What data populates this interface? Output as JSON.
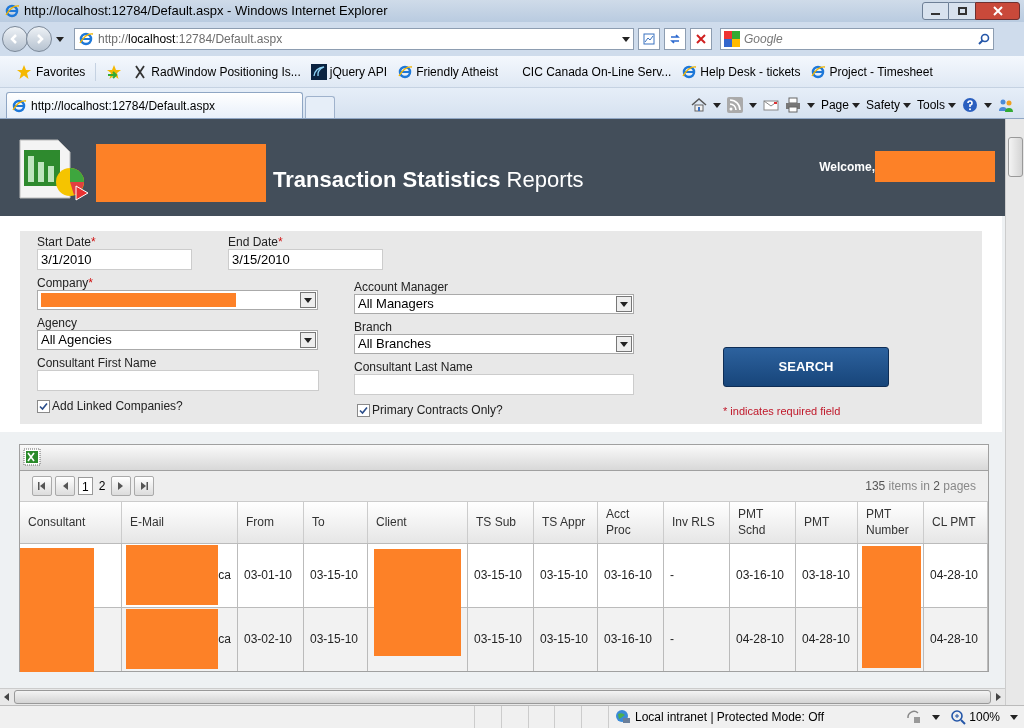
{
  "window": {
    "title": "http://localhost:12784/Default.aspx - Windows Internet Explorer"
  },
  "address_bar": {
    "host_prefix": "http://",
    "host": "localhost",
    "rest": ":12784/Default.aspx",
    "search_placeholder": "Google"
  },
  "favorites_bar": {
    "favorites_label": "Favorites",
    "links": [
      {
        "label": "RadWindow Positioning Is...",
        "kind": "cross"
      },
      {
        "label": "jQuery API",
        "kind": "swirl"
      },
      {
        "label": "Friendly Atheist",
        "kind": "ie"
      },
      {
        "label": "CIC Canada  On-Line Serv...",
        "kind": "plain"
      },
      {
        "label": "Help Desk - tickets",
        "kind": "ie"
      },
      {
        "label": "Project - Timesheet",
        "kind": "ie"
      }
    ]
  },
  "tab": {
    "label": "http://localhost:12784/Default.aspx"
  },
  "command_bar": [
    {
      "label": "Page"
    },
    {
      "label": "Safety"
    },
    {
      "label": "Tools"
    }
  ],
  "header": {
    "title_bold": "Transaction Statistics",
    "title_light": "Reports",
    "welcome": "Welcome,"
  },
  "form": {
    "fields": [
      {
        "label": "Start Date",
        "required": true,
        "kind": "text",
        "value": "3/1/2010"
      },
      {
        "label": "End Date",
        "required": true,
        "kind": "text",
        "value": "3/15/2010"
      },
      {
        "label": "Company",
        "required": true,
        "kind": "select",
        "redacted": true
      },
      {
        "label": "Account Manager",
        "required": false,
        "kind": "select",
        "value": "All Managers"
      },
      {
        "label": "Agency",
        "required": false,
        "kind": "select",
        "value": "All Agencies"
      },
      {
        "label": "Branch",
        "required": false,
        "kind": "select",
        "value": "All Branches"
      },
      {
        "label": "Consultant First Name",
        "required": false,
        "kind": "text"
      },
      {
        "label": "Consultant Last Name",
        "required": false,
        "kind": "text"
      }
    ],
    "required_mark": "*",
    "checkboxes": [
      {
        "label": "Add Linked Companies?",
        "checked": true
      },
      {
        "label": "Primary Contracts Only?",
        "checked": true
      }
    ],
    "search_button": "SEARCH",
    "required_note": "* indicates required field"
  },
  "grid": {
    "pages": [
      {
        "label": "1",
        "selected": true
      },
      {
        "label": "2",
        "selected": false
      }
    ],
    "items_count": "135",
    "items_text": "items in",
    "pages_count": "2",
    "pages_text": "pages",
    "columns": [
      "Consultant",
      "E-Mail",
      "From",
      "To",
      "Client",
      "TS Sub",
      "TS Appr",
      "Acct Proc",
      "Inv RLS",
      "PMT Schd",
      "PMT",
      "PMT Number",
      "CL PMT"
    ],
    "rows": [
      {
        "cells": [
          "",
          "ca",
          "03-01-10",
          "03-15-10",
          "",
          "03-15-10",
          "03-15-10",
          "03-16-10",
          "-",
          "03-16-10",
          "03-18-10",
          "",
          "04-28-10"
        ]
      },
      {
        "cells": [
          "",
          "ca",
          "03-02-10",
          "03-15-10",
          "",
          "03-15-10",
          "03-15-10",
          "03-16-10",
          "-",
          "04-28-10",
          "04-28-10",
          "",
          "04-28-10"
        ]
      }
    ]
  },
  "status_bar": {
    "zone": "Local intranet | Protected Mode: Off",
    "zoom": "100%"
  }
}
